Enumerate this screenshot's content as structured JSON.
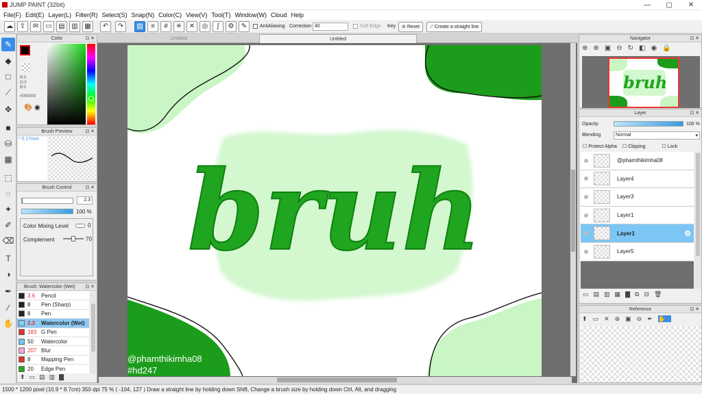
{
  "app": {
    "title": "JUMP PAINT (32bit)"
  },
  "menu": [
    "File(F)",
    "Edit(E)",
    "Layer(L)",
    "Filter(R)",
    "Select(S)",
    "Snap(N)",
    "Color(C)",
    "View(V)",
    "Tool(T)",
    "Window(W)",
    "Cloud",
    "Help"
  ],
  "toolbar": {
    "antialiasing": "AntiAliasing",
    "correction_label": "Correction",
    "correction_value": "40",
    "soft_edge": "Soft Edge",
    "key": "Key",
    "reset": "Reset",
    "straight_line": "Create a straight line"
  },
  "color_panel": {
    "title": "Color",
    "r": "R:0",
    "g": "G:0",
    "b": "B:0",
    "hex": "#000000",
    "fg": "#000000"
  },
  "brush_preview": {
    "title": "Brush Preview",
    "size": "0.17mm"
  },
  "brush_control": {
    "title": "Brush Control",
    "size": "2.3",
    "opacity": "100 %",
    "mixing_label": "Color Mixing Level",
    "mixing_value": "0",
    "complement_label": "Complement",
    "complement_value": "70"
  },
  "brush_list": {
    "title": "Brush: Watercolor (Wet)",
    "items": [
      {
        "size": "3.6",
        "name": "Pencil",
        "color": "#222222",
        "red": true
      },
      {
        "size": "8",
        "name": "Pen (Sharp)",
        "color": "#222222",
        "red": false
      },
      {
        "size": "8",
        "name": "Pen",
        "color": "#222222",
        "red": false
      },
      {
        "size": "2.3",
        "name": "Watercolor (Wet)",
        "color": "#7fd0f5",
        "red": true
      },
      {
        "size": "183",
        "name": "G Pen",
        "color": "#e0322e",
        "red": true
      },
      {
        "size": "50",
        "name": "Watercolor",
        "color": "#6fc8f2",
        "red": false
      },
      {
        "size": "207",
        "name": "Blur",
        "color": "#f4a6d8",
        "red": true
      },
      {
        "size": "8",
        "name": "Mapping Pen",
        "color": "#e0322e",
        "red": false
      },
      {
        "size": "20",
        "name": "Edge Pen",
        "color": "#22aa22",
        "red": false
      }
    ]
  },
  "tabs": [
    "Untitled",
    "Untitled"
  ],
  "artwork": {
    "word": "bruh",
    "credit1": "@phamthikimha08",
    "credit2": "#hd247",
    "green": "#1a9a1a",
    "light": "#c9f3c6"
  },
  "navigator": {
    "title": "Navigator",
    "thumb_word": "bruh"
  },
  "layer_panel": {
    "title": "Layer",
    "opacity_label": "Opacity",
    "opacity_value": "100 %",
    "blending_label": "Blending",
    "blending_value": "Normal",
    "protect_alpha": "Protect Alpha",
    "clipping": "Clipping",
    "lock": "Lock",
    "layers": [
      {
        "name": "@phamthikimha08",
        "active": false
      },
      {
        "name": "Layer4",
        "active": false
      },
      {
        "name": "Layer3",
        "active": false
      },
      {
        "name": "Layer1",
        "active": false
      },
      {
        "name": "Layer1",
        "active": true
      },
      {
        "name": "Layer5",
        "active": false
      }
    ]
  },
  "reference": {
    "title": "Reference"
  },
  "status": {
    "text": "1500 * 1200 pixel   (10.9 * 8.7cm)   350 dpi   75 %   ( -104, 127 )   Draw a straight line by holding down Shift, Change a brush size by holding down Ctrl, Alt, and dragging"
  }
}
